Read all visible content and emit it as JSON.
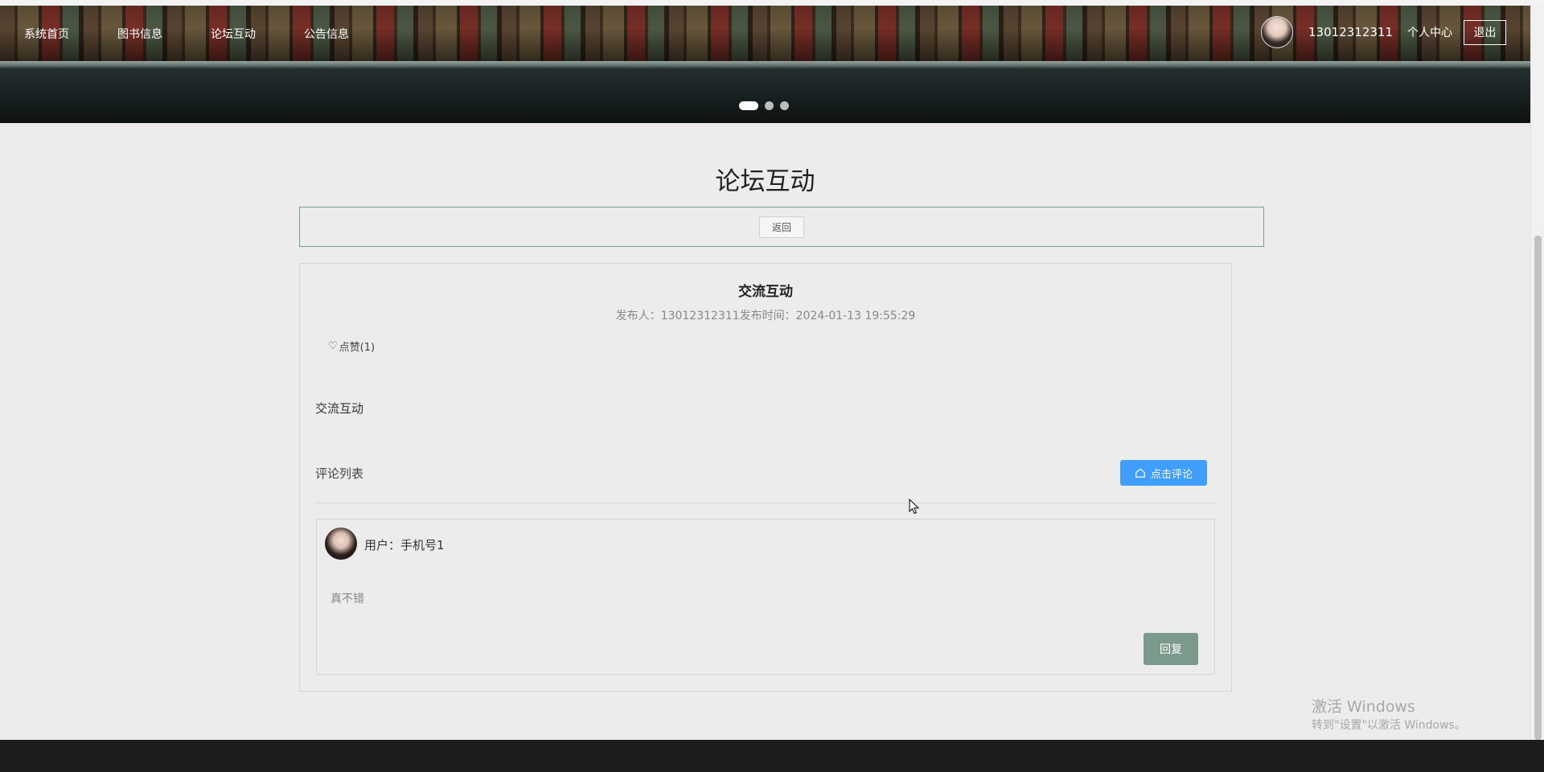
{
  "nav": {
    "items": [
      {
        "label": "系统首页"
      },
      {
        "label": "图书信息"
      },
      {
        "label": "论坛互动"
      },
      {
        "label": "公告信息"
      }
    ],
    "user_phone": "13012312311",
    "user_center": "个人中心",
    "logout": "退出"
  },
  "carousel": {
    "slide_count": 3,
    "active_index": 0
  },
  "page": {
    "title": "论坛互动",
    "back_label": "返回"
  },
  "post": {
    "title": "交流互动",
    "meta": "发布人：13012312311发布时间：2024-01-13 19:55:29",
    "like_label": "点赞(1)",
    "content": "交流互动"
  },
  "comments": {
    "header": "评论列表",
    "add_button": "点击评论",
    "items": [
      {
        "user": "用户：手机号1",
        "text": "真不错",
        "reply_label": "回复"
      }
    ]
  },
  "watermark": {
    "line1": "激活 Windows",
    "line2": "转到\"设置\"以激活 Windows。"
  },
  "colors": {
    "accent_blue": "#409eff",
    "reply_green": "#7b9a8b",
    "page_bg": "#ececec",
    "footer_bg": "#1c1c1c"
  }
}
